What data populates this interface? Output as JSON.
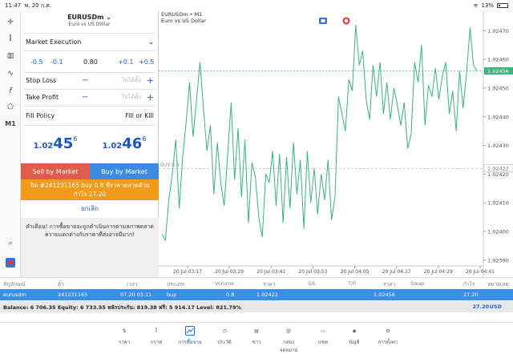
{
  "status": {
    "time": "11:47",
    "date": "พ. 20 ก.ค.",
    "battery": "13%"
  },
  "left_toolbar": {
    "timeframe": "M1"
  },
  "symbol": {
    "name": "EURUSDm",
    "description": "Euro vs US Dollar"
  },
  "order": {
    "type": "Market Execution",
    "volume_steps": [
      "-0.5",
      "-0.1",
      "+0.1",
      "+0.5"
    ],
    "volume": "0.80",
    "stop_loss_label": "Stop Loss",
    "take_profit_label": "Take Profit",
    "not_set": "ไม่ได้ตั้ง",
    "fill_policy_label": "Fill Policy",
    "fill_policy_value": "Fill or Kill",
    "bid": {
      "prefix": "1.02",
      "big": "45",
      "sup": "6"
    },
    "ask": {
      "prefix": "1.02",
      "big": "46",
      "sup": "6"
    },
    "sell_label": "Sell by Market",
    "buy_label": "Buy by Market",
    "banner_line1": "ปิด #241231165 buy 0.8 ที่ราคาตลาดด้วย",
    "banner_line2": "กำไร 27.20",
    "cancel_label": "ยกเลิก",
    "warning": "คำเตือน! การซื้อขายจะถูกดำเนินการตามสภาพตลาด ความแตกต่างกับราคาที่ส่งอาจมีมาก!"
  },
  "chart_data": {
    "type": "line",
    "title": "EURUSDm • M1",
    "subtitle": "Euro vs US Dollar",
    "x_tick_labels": [
      "20 Jul 03:17",
      "20 Jul 03:29",
      "20 Jul 03:41",
      "20 Jul 03:53",
      "20 Jul 04:05",
      "20 Jul 04:17",
      "20 Jul 04:29",
      "20 Jul 04:41"
    ],
    "y_tick_labels": [
      "1.02470",
      "1.02460",
      "1.02450",
      "1.02440",
      "1.02430",
      "1.02420",
      "1.02410",
      "1.02400",
      "1.02390"
    ],
    "ylim": [
      1.02388,
      1.02474
    ],
    "current_price_label": "1.02456",
    "buy_line_label": "BUY 0.8",
    "buy_price_label": "1.02422",
    "values": [
      1.02399,
      1.02397,
      1.02411,
      1.0242,
      1.02432,
      1.02408,
      1.02426,
      1.02438,
      1.02452,
      1.02433,
      1.02446,
      1.02459,
      1.02443,
      1.02428,
      1.02437,
      1.02413,
      1.02431,
      1.02417,
      1.02409,
      1.02427,
      1.02445,
      1.02418,
      1.02436,
      1.02412,
      1.02432,
      1.02403,
      1.02424,
      1.02419,
      1.02405,
      1.02398,
      1.0242,
      1.02417,
      1.02428,
      1.02409,
      1.02427,
      1.02403,
      1.02426,
      1.02408,
      1.02431,
      1.02413,
      1.02425,
      1.02401,
      1.02428,
      1.0241,
      1.02422,
      1.02406,
      1.0242,
      1.02411,
      1.02425,
      1.02404,
      1.02412,
      1.02447,
      1.02441,
      1.02435,
      1.02453,
      1.02449,
      1.02472,
      1.02458,
      1.02463,
      1.02446,
      1.02439,
      1.02458,
      1.02447,
      1.02459,
      1.02441,
      1.02452,
      1.02439,
      1.0245,
      1.02444,
      1.02437,
      1.02445,
      1.02429,
      1.02434,
      1.02459,
      1.02452,
      1.02465,
      1.02437,
      1.02451,
      1.02447,
      1.02457,
      1.02446,
      1.02454,
      1.02459,
      1.02441,
      1.02449,
      1.02435,
      1.02456,
      1.02443,
      1.02455,
      1.02471,
      1.02458,
      1.02456
    ]
  },
  "positions": {
    "headers": [
      "สัญลักษณ์",
      "ตั๋ว",
      "เวลา",
      "ประเภท",
      "Volume",
      "ราคา",
      "S/L",
      "T/P",
      "ราคา",
      "Swap",
      "กำไร",
      "หมายเหตุ"
    ],
    "row": [
      "eurusdm",
      "241231165",
      "07.20 03:11",
      "buy",
      "0.8",
      "1.02422",
      "",
      "",
      "1.02456",
      "",
      "27.20",
      ""
    ],
    "balance_text": "Balance: 6 706.35 Equity: 6 733.55 หลักประกัน: 819.38 ฟรี: 5 914.17 Level: 821.79%",
    "total_profit": "27.20",
    "currency": "USD"
  },
  "tabs": [
    {
      "label": "ราคา",
      "icon": "arrows-icon"
    },
    {
      "label": "กราฟ",
      "icon": "candles-icon"
    },
    {
      "label": "การซื้อขาย",
      "icon": "trade-icon",
      "active": true
    },
    {
      "label": "ประวัติ",
      "icon": "history-icon"
    },
    {
      "label": "ข่าว",
      "icon": "news-icon"
    },
    {
      "label": "กล่องจดหมาย",
      "icon": "mail-icon"
    },
    {
      "label": "แชท",
      "icon": "chat-icon"
    },
    {
      "label": "บัญชี",
      "icon": "account-icon"
    },
    {
      "label": "การตั้งค่า",
      "icon": "settings-icon"
    }
  ]
}
